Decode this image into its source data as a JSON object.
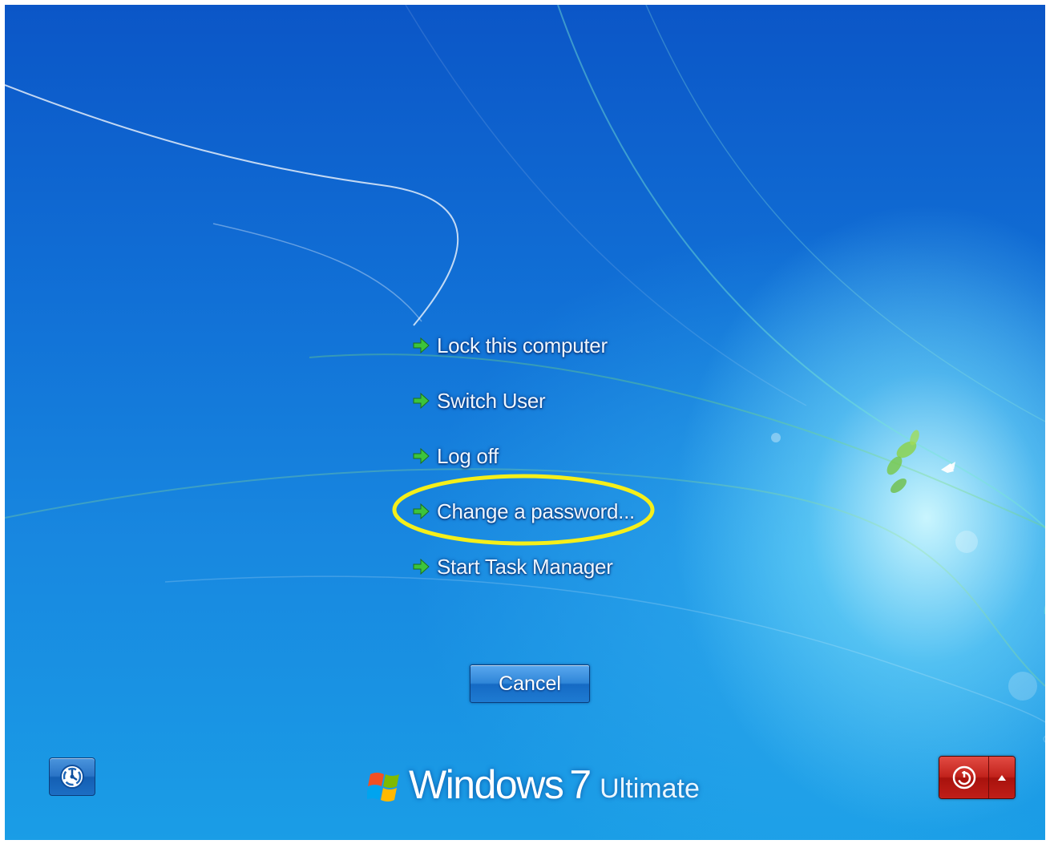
{
  "menu": {
    "items": [
      {
        "id": "lock",
        "label": "Lock this computer"
      },
      {
        "id": "switch-user",
        "label": "Switch User"
      },
      {
        "id": "log-off",
        "label": "Log off"
      },
      {
        "id": "change-password",
        "label": "Change a password..."
      },
      {
        "id": "task-manager",
        "label": "Start Task Manager"
      }
    ],
    "item_icon": "green-arrow-icon",
    "highlighted_item": "change-password",
    "highlight_color": "#f5ef1a"
  },
  "cancel_button": {
    "label": "Cancel"
  },
  "branding": {
    "name": "Windows",
    "version": "7",
    "edition": "Ultimate",
    "logo_icon": "windows-flag-icon"
  },
  "ease_of_access": {
    "icon": "ease-of-access-icon"
  },
  "power": {
    "icon": "power-icon",
    "options_icon": "triangle-up-icon",
    "color": "#c2231c"
  },
  "colors": {
    "background_top": "#0b56c7",
    "background_bottom": "#1a9de6",
    "arrow_green": "#3cc43c"
  }
}
